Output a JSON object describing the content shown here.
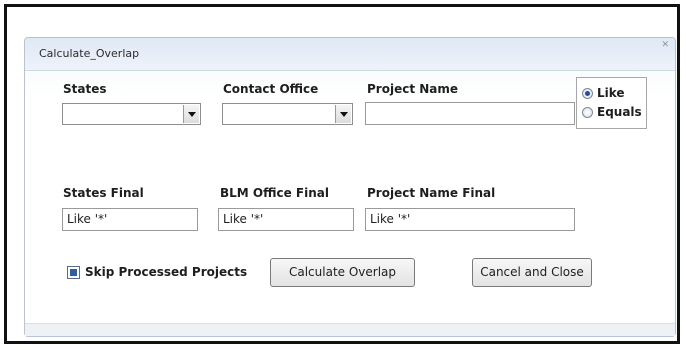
{
  "window": {
    "title": "Calculate_Overlap"
  },
  "filters": {
    "states": {
      "label": "States",
      "value": ""
    },
    "contact_office": {
      "label": "Contact Office",
      "value": ""
    },
    "project_name": {
      "label": "Project Name",
      "value": ""
    },
    "match_mode": {
      "options": [
        {
          "label": "Like",
          "checked": true
        },
        {
          "label": "Equals",
          "checked": false
        }
      ]
    }
  },
  "finals": {
    "states_final": {
      "label": "States Final",
      "value": "Like '*'"
    },
    "blm_office_final": {
      "label": "BLM Office Final",
      "value": "Like '*'"
    },
    "project_name_final": {
      "label": "Project Name Final",
      "value": "Like '*'"
    }
  },
  "actions": {
    "skip_processed": {
      "label": "Skip Processed Projects",
      "checked": true
    },
    "calculate_label": "Calculate Overlap",
    "cancel_label": "Cancel and Close"
  }
}
